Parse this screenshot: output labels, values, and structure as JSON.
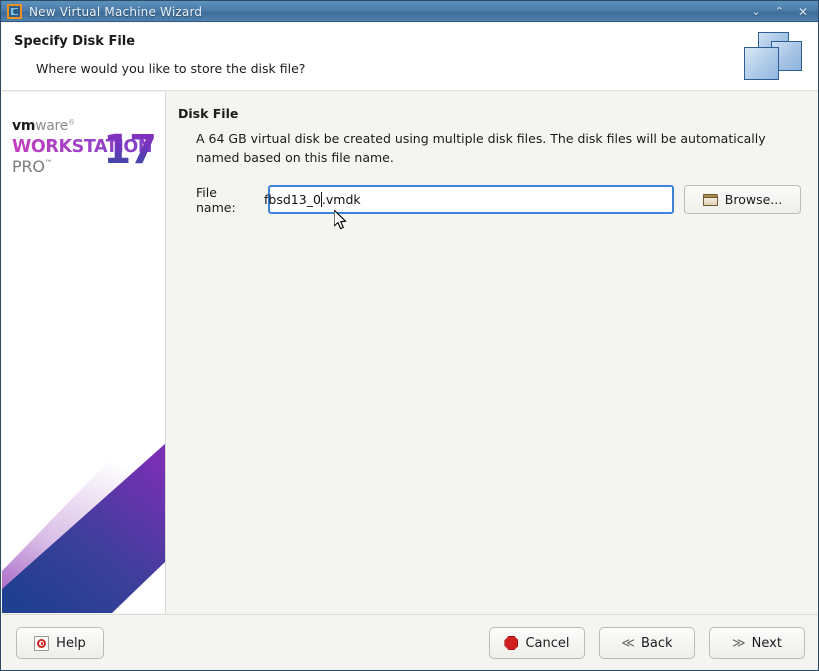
{
  "window": {
    "title": "New Virtual Machine Wizard",
    "icon": "vmware-app-icon",
    "controls": {
      "minimize": "⌄",
      "maximize": "⌃",
      "close": "✕"
    }
  },
  "header": {
    "title": "Specify Disk File",
    "subtitle": "Where would you like to store the disk file?",
    "artwork": "stacked-disks-icon"
  },
  "sidebar": {
    "brand_vm": "vm",
    "brand_ware": "ware",
    "brand_reg": "®",
    "brand_product": "WORKSTATION",
    "brand_edition": "PRO",
    "brand_tm": "™",
    "brand_version": "17"
  },
  "main": {
    "section_title": "Disk File",
    "section_description": "A 64 GB virtual disk be created using multiple disk files. The disk files will be automatically named based on this file name.",
    "filename_label": "File name:",
    "filename_value": "fbsd13_0.vmdk",
    "filename_before_caret": "fbsd13_0",
    "filename_after_caret": ".vmdk",
    "filename_placeholder": "",
    "browse_label": "Browse..."
  },
  "footer": {
    "help_label": "Help",
    "cancel_label": "Cancel",
    "back_label": "Back",
    "next_label": "Next",
    "back_glyph": "≪",
    "next_glyph": "≫"
  },
  "colors": {
    "titlebar_blue": "#4b7ba8",
    "accent_purple": "#7a3fc4",
    "accent_magenta": "#c53fc0",
    "focus_blue": "#3b84d8",
    "content_bg": "#f4f4f1",
    "stop_red": "#cf1f1f"
  }
}
